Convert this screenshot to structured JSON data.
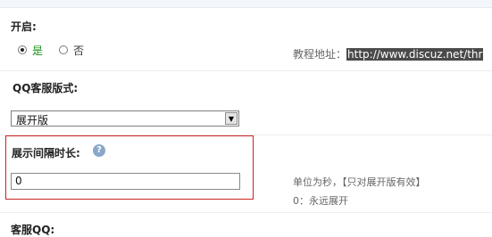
{
  "open_setting": {
    "label": "开启:",
    "options": [
      {
        "label": "是",
        "checked": true
      },
      {
        "label": "否",
        "checked": false
      }
    ],
    "tutorial_prefix": "教程地址：",
    "tutorial_url": "http://www.discuz.net/thr"
  },
  "qq_style": {
    "label": "QQ客服版式:",
    "selected": "展开版"
  },
  "interval": {
    "label": "展示间隔时长:",
    "help_icon": "?",
    "value": "0",
    "hint_line1": "单位为秒，【只对展开版有效】",
    "hint_line2": "0：永远展开"
  },
  "next_section": {
    "label": "客服QQ:"
  },
  "colors": {
    "highlight_border": "#cc2222",
    "checked_text": "#1a8f1a"
  }
}
